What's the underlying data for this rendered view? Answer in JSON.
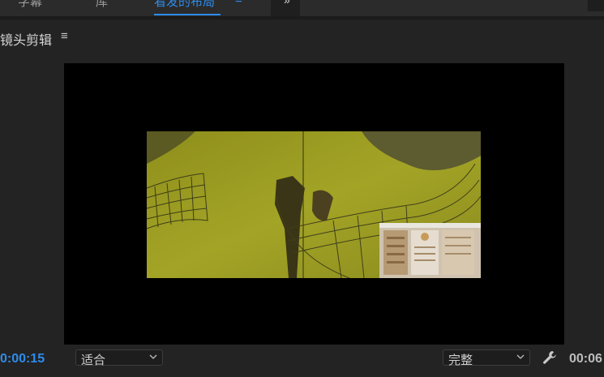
{
  "workspace_tabs": [
    {
      "label": "字幕",
      "active": false
    },
    {
      "label": "库",
      "active": false
    },
    {
      "label": "看发的布局",
      "active": true
    }
  ],
  "workspace_menu_glyph": "≡",
  "overflow_glyph": "»",
  "panel": {
    "title": "镜头剪辑",
    "menu_glyph": "≡"
  },
  "controls": {
    "current_time": "0:00:15",
    "zoom_value": "适合",
    "resolution_value": "完整",
    "duration": "00:06",
    "wrench_icon": "wrench-icon"
  },
  "colors": {
    "accent": "#2d8ceb",
    "video_tint": "#9a9a20",
    "canvas": "#000000"
  }
}
